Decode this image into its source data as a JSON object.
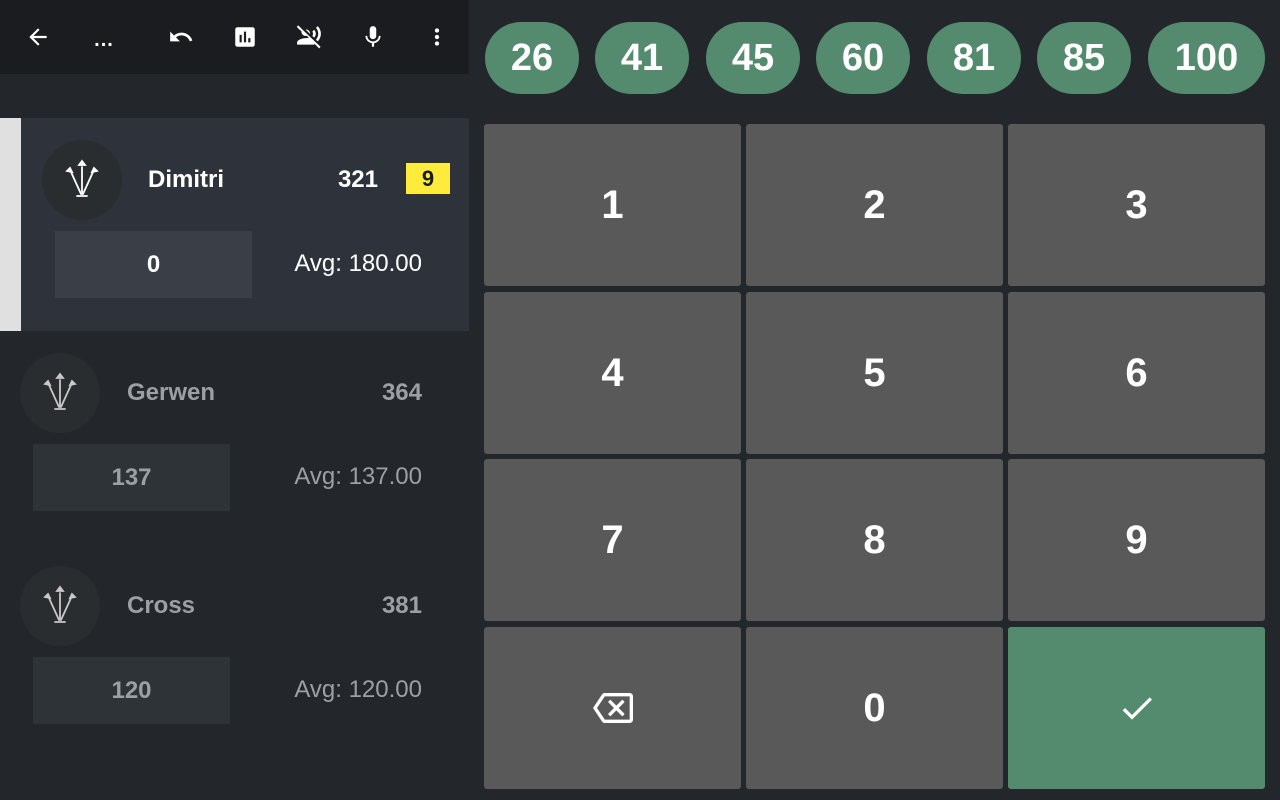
{
  "toolbar": {
    "back_icon": "arrow-back-icon",
    "overflow_label": "...",
    "undo_icon": "undo-icon",
    "stats_icon": "bar-chart-icon",
    "voice_off_icon": "voice-over-off-icon",
    "mic_icon": "mic-icon",
    "more_icon": "more-vert-icon"
  },
  "players": [
    {
      "name": "Dimitri",
      "score": "321",
      "darts": "9",
      "input": "0",
      "avg": "Avg: 180.00",
      "active": true,
      "avatar_icon": "darts-icon"
    },
    {
      "name": "Gerwen",
      "score": "364",
      "input": "137",
      "avg": "Avg: 137.00",
      "active": false,
      "avatar_icon": "darts-icon"
    },
    {
      "name": "Cross",
      "score": "381",
      "input": "120",
      "avg": "Avg: 120.00",
      "active": false,
      "avatar_icon": "darts-icon"
    }
  ],
  "quick_scores": [
    "26",
    "41",
    "45",
    "60",
    "81",
    "85",
    "100"
  ],
  "keypad": {
    "keys": [
      "1",
      "2",
      "3",
      "4",
      "5",
      "6",
      "7",
      "8",
      "9"
    ],
    "zero": "0",
    "backspace_icon": "backspace-icon",
    "confirm_icon": "check-icon"
  },
  "colors": {
    "accent_green": "#548b6e",
    "badge_yellow": "#ffeb3b",
    "key_gray": "#595959",
    "background": "#23272b"
  }
}
